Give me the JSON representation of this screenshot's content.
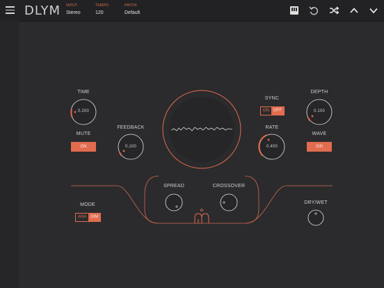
{
  "header": {
    "app_name": "DLYM",
    "input_label": "INPUT",
    "input_value": "Stereo",
    "tempo_label": "TEMPO",
    "tempo_value": "120",
    "patch_label": "PATCH",
    "patch_value": "Default"
  },
  "knobs": {
    "time": {
      "label": "TIME",
      "value": "0.200"
    },
    "feedback": {
      "label": "FEEDBACK",
      "value": "0.100"
    },
    "depth": {
      "label": "DEPTH",
      "value": "0.100"
    },
    "rate": {
      "label": "RATE",
      "value": "0.400"
    },
    "spread": {
      "label": "SPREAD"
    },
    "crossover": {
      "label": "CROSSOVER"
    },
    "drywet": {
      "label": "DRY/WET"
    }
  },
  "mute": {
    "label": "MUTE",
    "value": "ON"
  },
  "wave": {
    "label": "WAVE",
    "value": "SIN"
  },
  "sync": {
    "label": "SYNC",
    "off_option": "ON",
    "on_option": "OFF"
  },
  "mode": {
    "label": "MODE",
    "off_option": "ANA",
    "on_option": "DIM"
  },
  "colors": {
    "accent": "#e26c4f",
    "background": "#2b2b2d",
    "knob": "#262628"
  },
  "icons": [
    "menu-icon",
    "keyboard-icon",
    "undo-icon",
    "shuffle-icon",
    "chevron-up-icon",
    "chevron-down-icon",
    "logo-mark-icon"
  ]
}
